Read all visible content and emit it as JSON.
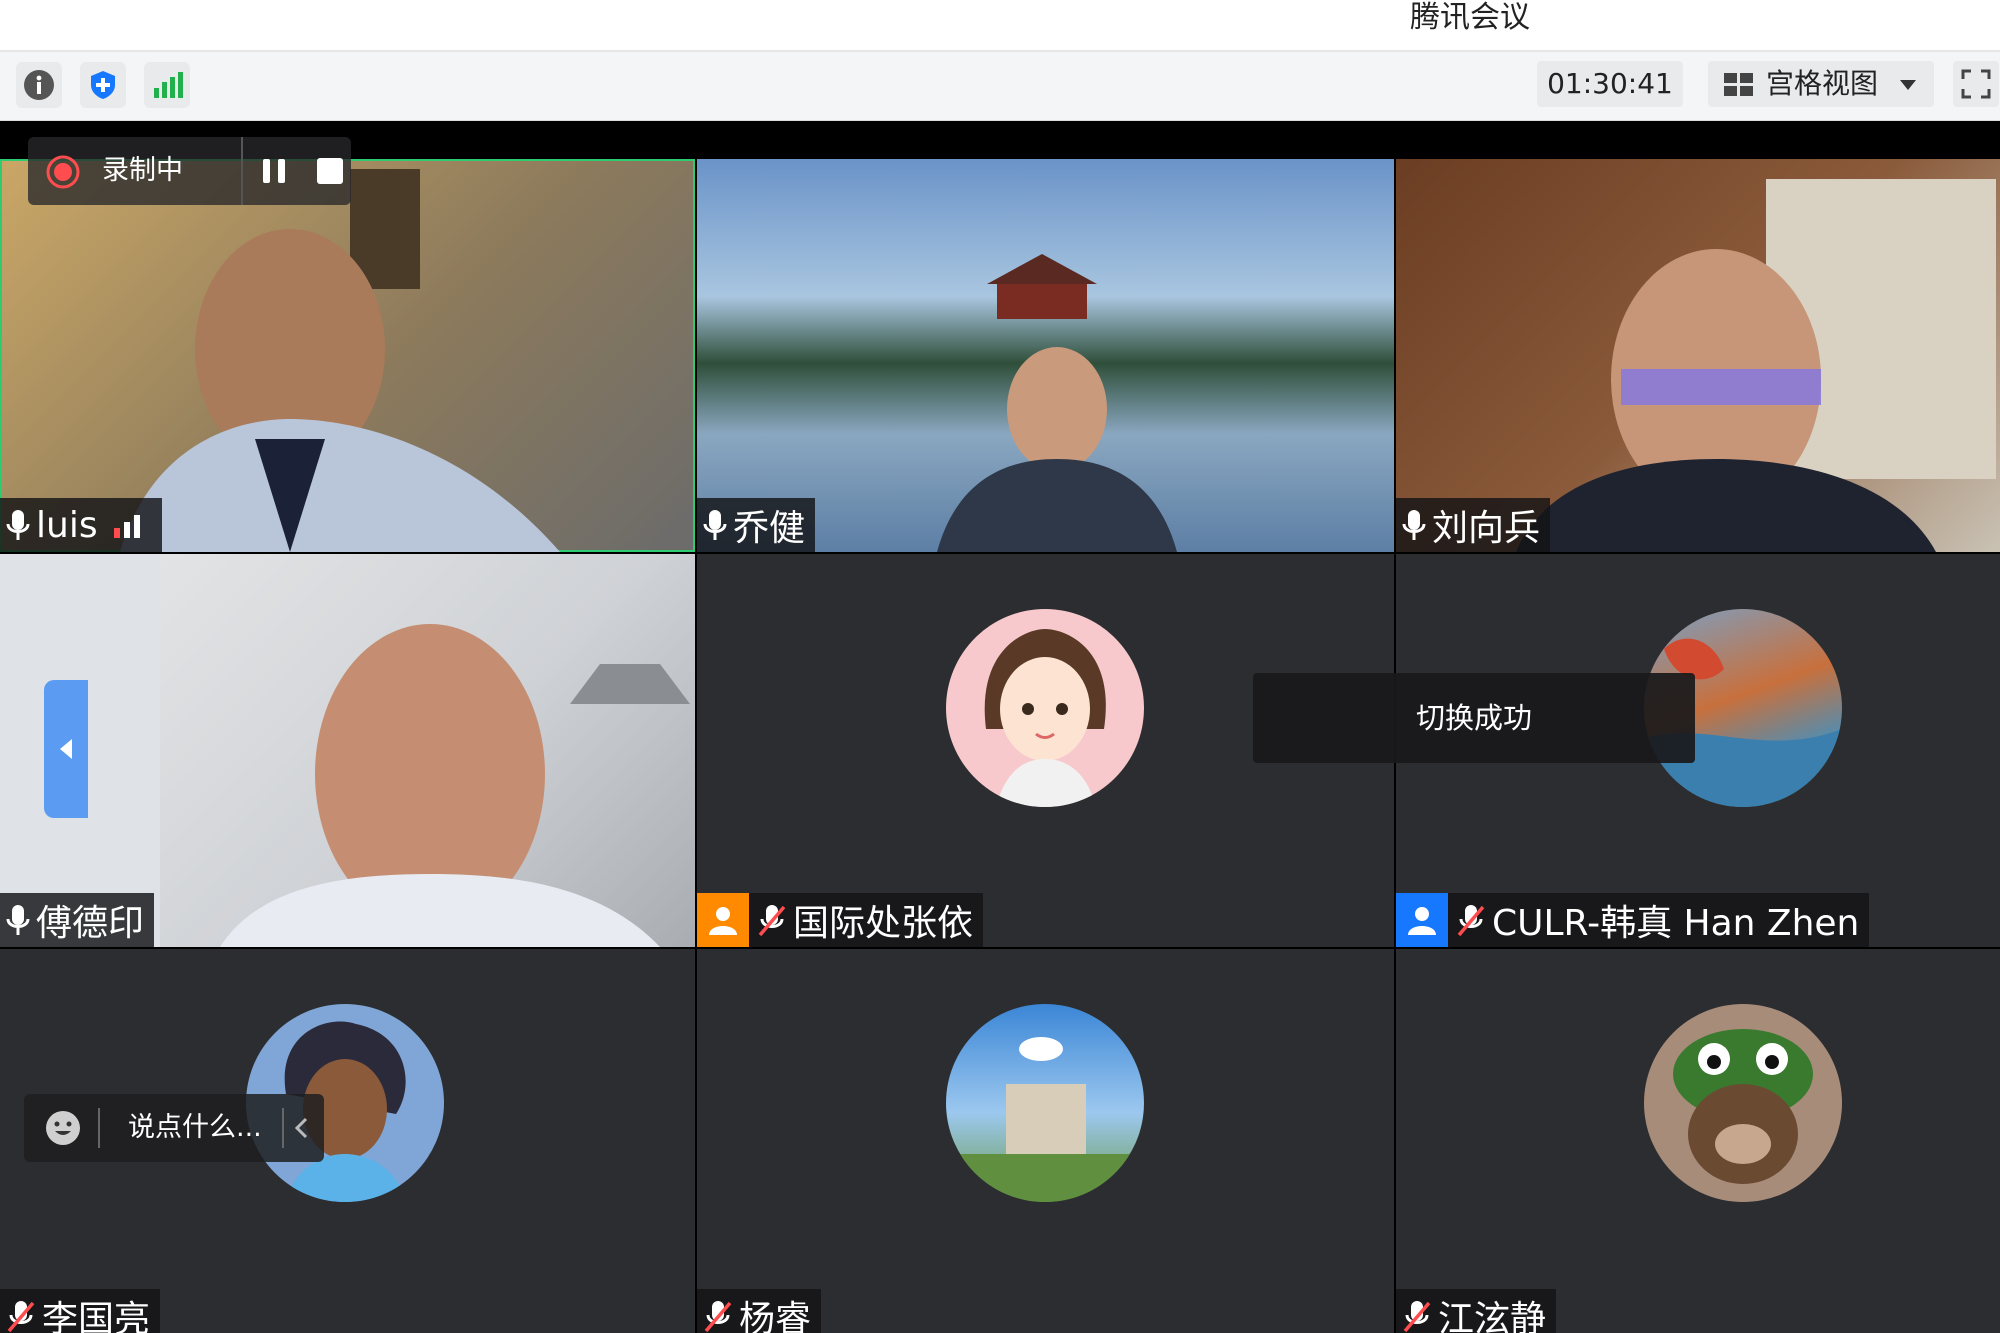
{
  "app": {
    "title": "腾讯会议"
  },
  "toolbar": {
    "icons": [
      "info-icon",
      "shield-icon",
      "signal-icon"
    ],
    "timer": "01:30:41",
    "view_mode": "宫格视图",
    "fullscreen_icon": "fullscreen-icon"
  },
  "recording": {
    "label": "录制中"
  },
  "toast": {
    "text": "切换成功"
  },
  "chat": {
    "placeholder": "说点什么..."
  },
  "participants": [
    {
      "name": "luis",
      "mic": "on",
      "video": true,
      "speaking": true
    },
    {
      "name": "乔健",
      "mic": "on",
      "video": true
    },
    {
      "name": "刘向兵",
      "mic": "on",
      "video": true
    },
    {
      "name": "傅德印",
      "mic": "on",
      "video": true
    },
    {
      "name": "国际处张依",
      "mic": "muted",
      "video": false,
      "tag_color": "#ff8a00"
    },
    {
      "name": "CULR-韩真 Han Zhen",
      "mic": "muted",
      "video": false,
      "tag_color": "#1677ff"
    },
    {
      "name": "李国亮",
      "mic": "muted",
      "video": false
    },
    {
      "name": "杨睿",
      "mic": "muted",
      "video": false
    },
    {
      "name": "江泫静",
      "mic": "muted",
      "video": false
    }
  ],
  "colors": {
    "active_border": "#2ecc71",
    "tile_bg": "#2c2d30",
    "accent_blue": "#1677ff"
  }
}
